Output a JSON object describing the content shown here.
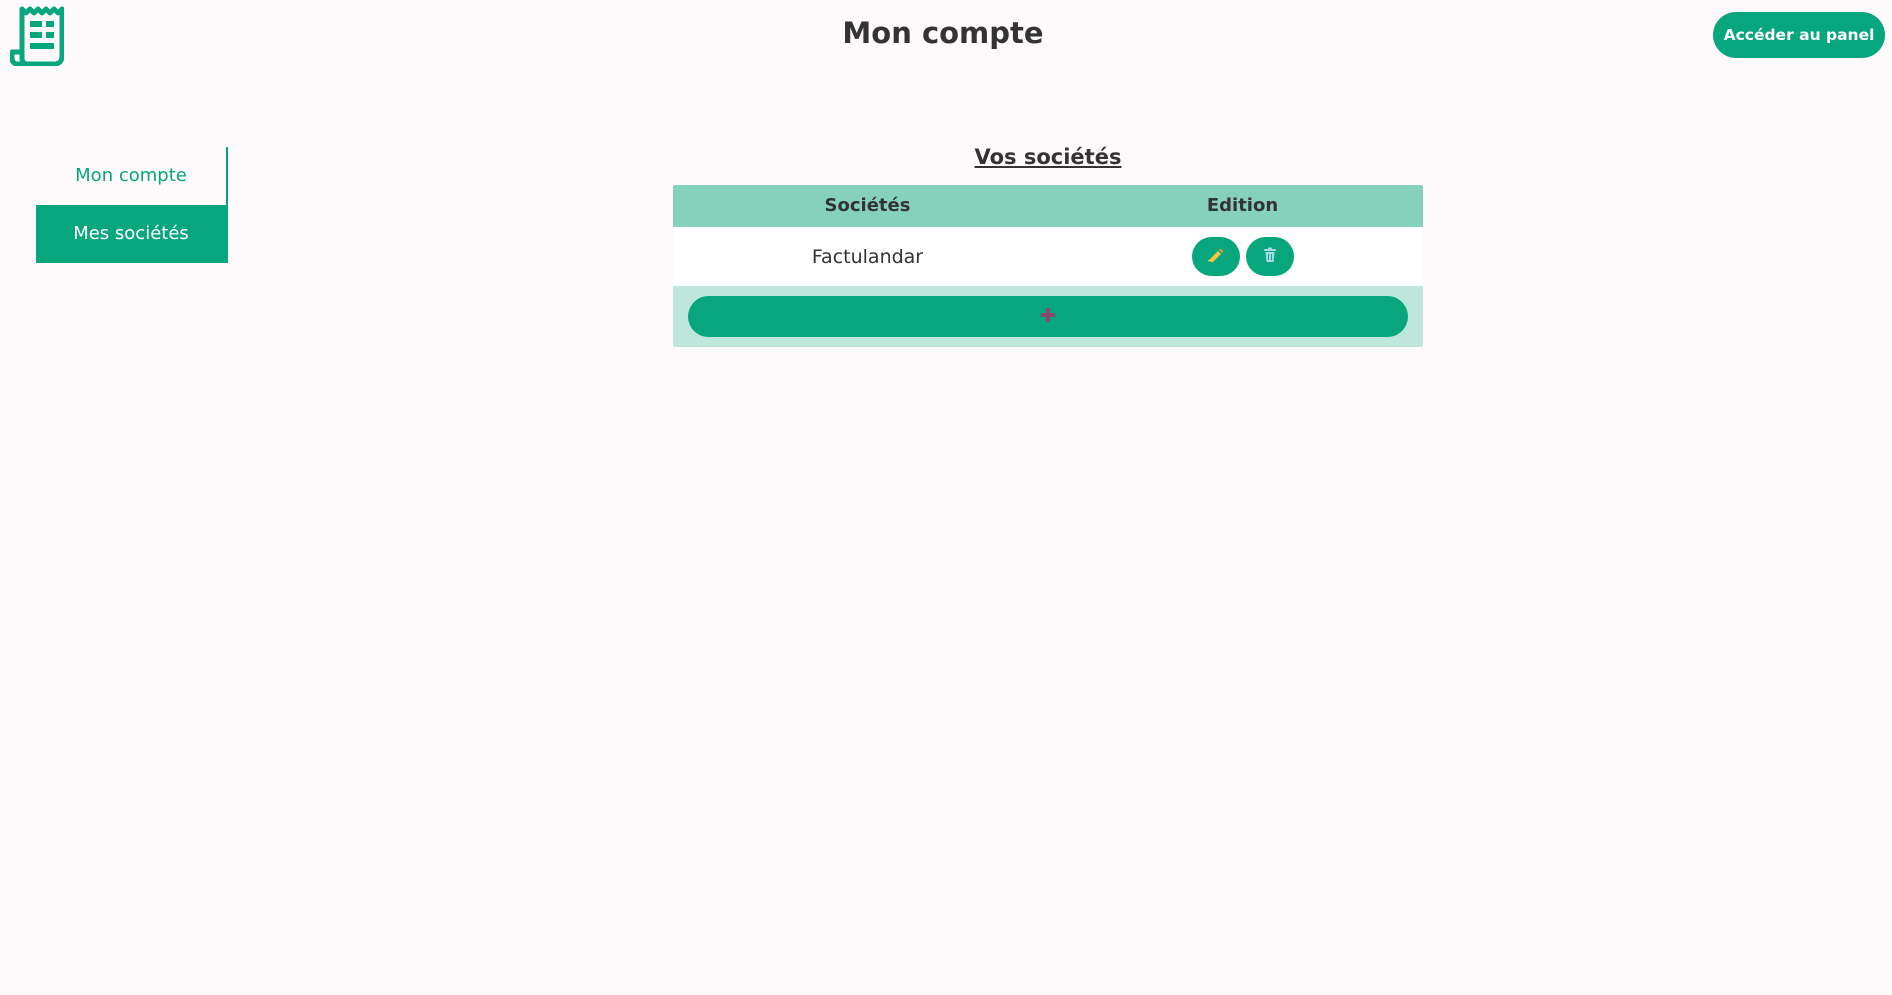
{
  "header": {
    "title": "Mon compte",
    "panel_button_label": "Accéder au panel",
    "logo_icon": "receipt-icon"
  },
  "sidebar": {
    "items": [
      {
        "label": "Mon compte",
        "active": false
      },
      {
        "label": "Mes sociétés",
        "active": true
      }
    ]
  },
  "main": {
    "section_title": "Vos sociétés",
    "table": {
      "columns": [
        "Sociétés",
        "Edition"
      ],
      "rows": [
        {
          "name": "Factulandar",
          "actions": [
            "edit-icon",
            "trash-icon"
          ]
        }
      ]
    },
    "add_button_icon": "plus-icon"
  },
  "colors": {
    "accent": "#07a67d",
    "table_header": "#85d1bc",
    "add_row_bg": "#bfe6db",
    "background": "#fef9fa",
    "text": "#333333"
  }
}
